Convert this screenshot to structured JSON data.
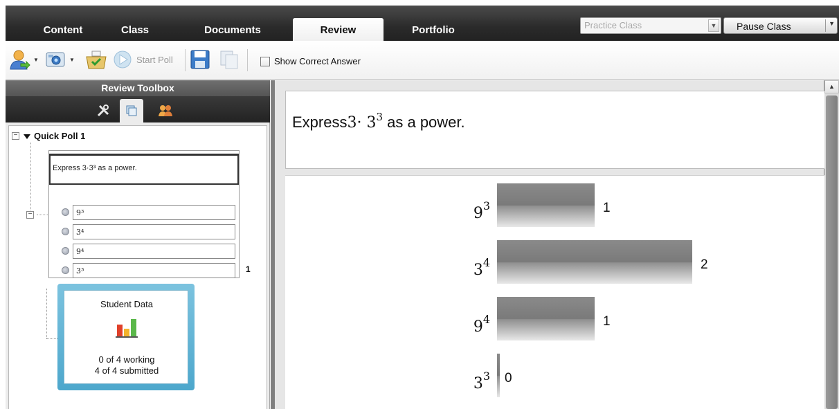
{
  "tabs": [
    "Content",
    "Class",
    "Documents",
    "Review",
    "Portfolio"
  ],
  "active_tab": "Review",
  "class_selector": {
    "value": "Practice Class"
  },
  "pause_button": {
    "label": "Pause Class"
  },
  "toolbar": {
    "icons": [
      "students-icon",
      "screen-capture-icon",
      "collect-icon",
      "start-poll-icon",
      "save-icon",
      "send-icon"
    ],
    "start_poll_label": "Start Poll",
    "show_correct_answer_label": "Show Correct Answer",
    "show_correct_answer_checked": false
  },
  "review_toolbox": {
    "title": "Review Toolbox",
    "tab_icons": [
      "tools-icon",
      "pages-icon",
      "students-icon"
    ],
    "active_tab_index": 1
  },
  "tree": {
    "poll_name": "Quick Poll 1",
    "thumbnail_question": "Express 3·3³ as a power.",
    "thumbnail_options": [
      "9³",
      "3⁴",
      "9⁴",
      "3³"
    ],
    "thumbnail_count": "1"
  },
  "student_data": {
    "title": "Student Data",
    "working": "0 of 4 working",
    "submitted": "4 of 4 submitted"
  },
  "question": {
    "prefix": "Express ",
    "math_base": "3· 3",
    "math_exp": "3",
    "suffix": " as a power."
  },
  "chart_data": {
    "type": "bar",
    "orientation": "horizontal",
    "categories": [
      {
        "base": "9",
        "exp": "3"
      },
      {
        "base": "3",
        "exp": "4"
      },
      {
        "base": "9",
        "exp": "4"
      },
      {
        "base": "3",
        "exp": "3"
      }
    ],
    "values": [
      1,
      2,
      1,
      0
    ],
    "xlim": [
      0,
      2
    ],
    "grid": false,
    "bar_color": "#8c8c8c"
  }
}
